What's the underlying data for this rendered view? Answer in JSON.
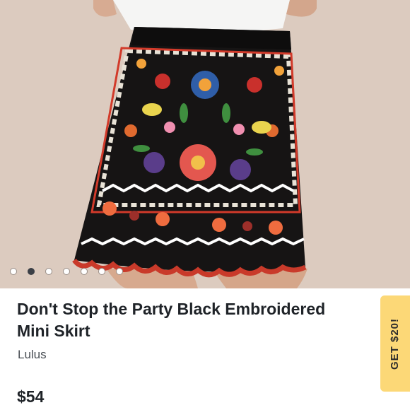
{
  "product": {
    "title": "Don't Stop the Party Black Embroidered Mini Skirt",
    "brand": "Lulus",
    "price": "$54"
  },
  "carousel": {
    "total_images": 7,
    "active_index": 1
  },
  "promo": {
    "label": "GET $20!"
  },
  "colors": {
    "accent_promo": "#fcd877",
    "dot_active": "#3b3f46",
    "text_primary": "#1f2328",
    "text_secondary": "#4a4f55"
  }
}
